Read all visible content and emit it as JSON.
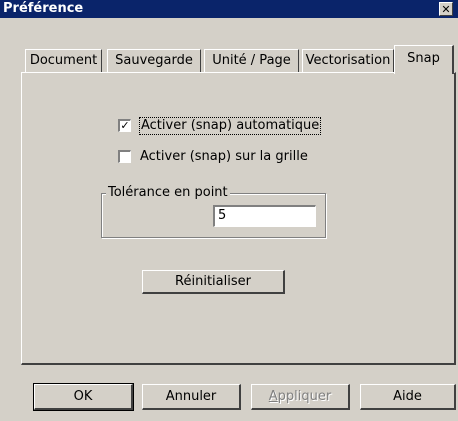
{
  "window": {
    "title": "Préférence",
    "close_glyph": "✕"
  },
  "tabs": [
    {
      "label": "Document",
      "active": false
    },
    {
      "label": "Sauvegarde",
      "active": false
    },
    {
      "label": "Unité / Page",
      "active": false
    },
    {
      "label": "Vectorisation",
      "active": false
    },
    {
      "label": "Snap",
      "active": true
    }
  ],
  "snap": {
    "auto_snap": {
      "label": "Activer (snap) automatique",
      "checked": true
    },
    "grid_snap": {
      "label": "Activer (snap) sur la grille",
      "checked": false
    },
    "tolerance": {
      "group_label": "Tolérance en point",
      "value": "5"
    },
    "reset_label": "Réinitialiser"
  },
  "footer": {
    "ok_label": "OK",
    "cancel_label": "Annuler",
    "apply_label_first": "A",
    "apply_label_rest": "ppliquer",
    "help_label": "Aide"
  }
}
